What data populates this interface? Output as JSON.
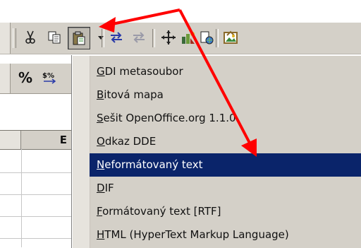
{
  "toolbar_top": {
    "icons": [
      "cut-icon",
      "copy-icon",
      "paste-special-icon",
      "link-icon",
      "unlink-icon",
      "navigator-icon",
      "gallery-icon",
      "data-sources-icon",
      "picture-icon"
    ]
  },
  "toolbar_format": {
    "percent_label": "%",
    "currency_label": "$%"
  },
  "sheet": {
    "visible_column_label": "E"
  },
  "paste_menu": {
    "items": [
      {
        "prefix": "",
        "mnemonic": "G",
        "rest": "DI metasoubor",
        "selected": false
      },
      {
        "prefix": "",
        "mnemonic": "B",
        "rest": "itová mapa",
        "selected": false
      },
      {
        "prefix": "",
        "mnemonic": "S",
        "rest": "ešit OpenOffice.org 1.1.0",
        "selected": false
      },
      {
        "prefix": "",
        "mnemonic": "O",
        "rest": "dkaz DDE",
        "selected": false
      },
      {
        "prefix": "",
        "mnemonic": "N",
        "rest": "eformátovaný text",
        "selected": true
      },
      {
        "prefix": "",
        "mnemonic": "D",
        "rest": "IF",
        "selected": false
      },
      {
        "prefix": "",
        "mnemonic": "F",
        "rest": "ormátovaný text [RTF]",
        "selected": false
      },
      {
        "prefix": "",
        "mnemonic": "H",
        "rest": "TML (HyperText Markup Language)",
        "selected": false
      }
    ]
  },
  "colors": {
    "highlight": "#0a246a",
    "arrow": "#ff0000",
    "toolbar_bg": "#d4d0c8"
  }
}
